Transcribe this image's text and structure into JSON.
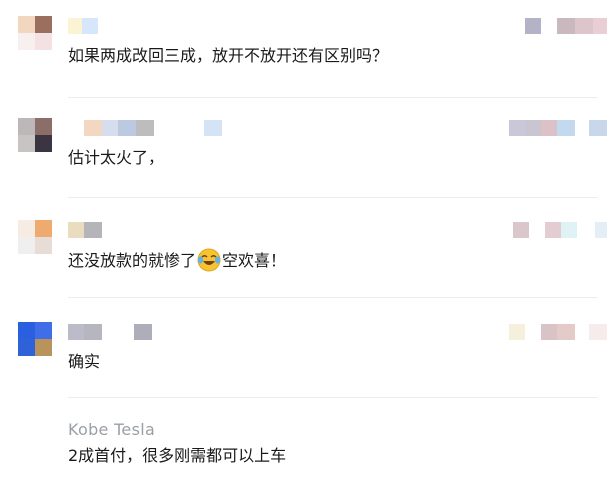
{
  "comments": [
    {
      "text": "如果两成改回三成，放开不放开还有区别吗？"
    },
    {
      "text": "估计太火了，"
    },
    {
      "text_before": "还没放款的就惨了",
      "emoji": "crying-laughing-face-icon",
      "text_after": "空欢喜！"
    },
    {
      "text": "确实"
    },
    {
      "author": "Kobe Tesla",
      "text": "2成首付，很多刚需都可以上车"
    }
  ]
}
